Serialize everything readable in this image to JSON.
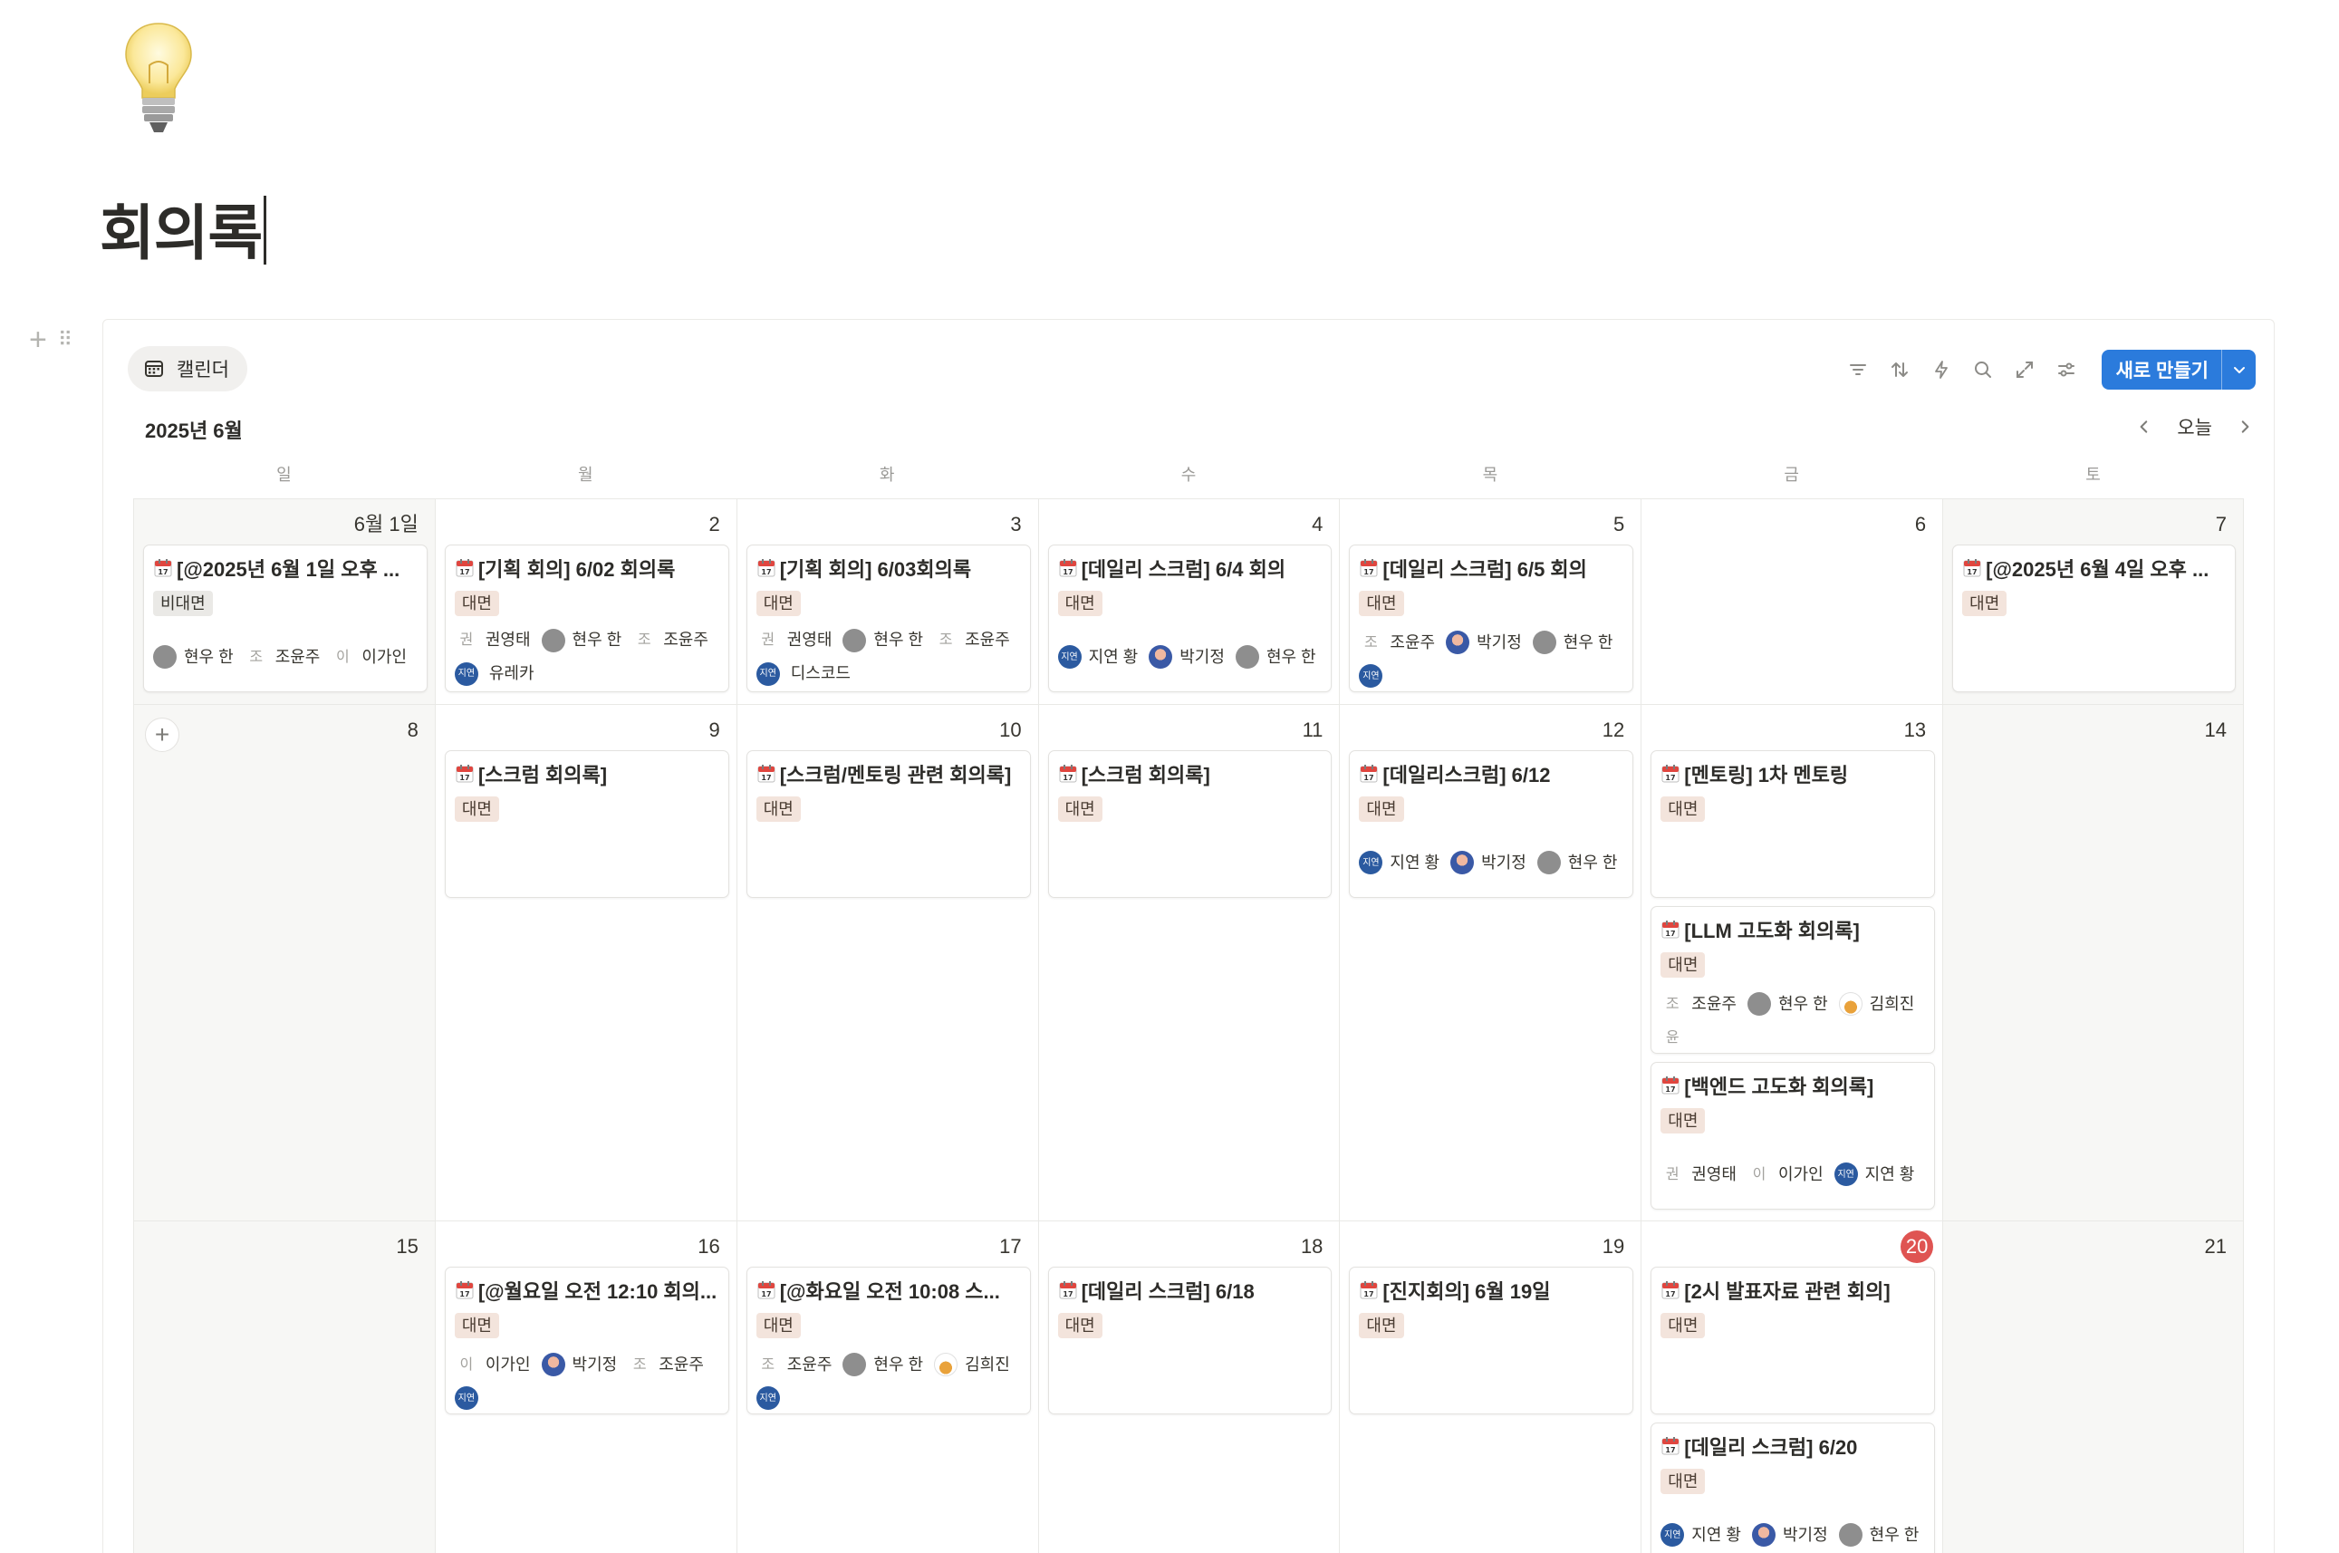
{
  "page": {
    "title": "회의록",
    "icon": "lightbulb-icon"
  },
  "view": {
    "tab_label": "캘린더",
    "month_label": "2025년 6월",
    "today_label": "오늘"
  },
  "toolbar": {
    "new_label": "새로 만들기",
    "accent": "#2b7bdc"
  },
  "weekdays": [
    "일",
    "월",
    "화",
    "수",
    "목",
    "금",
    "토"
  ],
  "tags": {
    "face": "대면",
    "nonface": "비대면"
  },
  "colors": {
    "tag_face_bg": "#f3e4dc",
    "tag_nonface_bg": "#eae9e6",
    "today": "#df5452"
  },
  "weeks": [
    {
      "days": [
        {
          "num": "6월 1일",
          "events": [
            {
              "title": "[@2025년 6월 1일 오후 ...",
              "tag": "비대면",
              "people": [
                {
                  "name": "현우 한",
                  "av": "gray"
                },
                {
                  "name": "조윤주",
                  "av": "조"
                },
                {
                  "name": "이가인",
                  "av": "이"
                }
              ]
            }
          ]
        },
        {
          "num": "2",
          "events": [
            {
              "title": "[기획 회의] 6/02 회의록",
              "tag": "대면",
              "people": [
                {
                  "name": "권영태",
                  "av": "권"
                },
                {
                  "name": "현우 한",
                  "av": "gray"
                },
                {
                  "name": "조윤주",
                  "av": "조"
                },
                {
                  "name": "",
                  "av": "blue"
                },
                {
                  "name": "유레카",
                  "av": ""
                }
              ]
            }
          ]
        },
        {
          "num": "3",
          "events": [
            {
              "title": "[기획 회의] 6/03회의록",
              "tag": "대면",
              "people": [
                {
                  "name": "권영태",
                  "av": "권"
                },
                {
                  "name": "현우 한",
                  "av": "gray"
                },
                {
                  "name": "조윤주",
                  "av": "조"
                },
                {
                  "name": "",
                  "av": "blue"
                },
                {
                  "name": "디스코드",
                  "av": ""
                }
              ]
            }
          ]
        },
        {
          "num": "4",
          "events": [
            {
              "title": "[데일리 스크럼] 6/4 회의",
              "tag": "대면",
              "people": [
                {
                  "name": "지연 황",
                  "av": "blue"
                },
                {
                  "name": "박기정",
                  "av": "photo"
                },
                {
                  "name": "현우 한",
                  "av": "gray"
                }
              ]
            }
          ]
        },
        {
          "num": "5",
          "events": [
            {
              "title": "[데일리 스크럼] 6/5 회의",
              "tag": "대면",
              "people": [
                {
                  "name": "조윤주",
                  "av": "조"
                },
                {
                  "name": "박기정",
                  "av": "photo"
                },
                {
                  "name": "현우 한",
                  "av": "gray"
                },
                {
                  "name": "",
                  "av": "blue"
                }
              ]
            }
          ]
        },
        {
          "num": "6",
          "events": []
        },
        {
          "num": "7",
          "events": [
            {
              "title": "[@2025년 6월 4일 오후 ...",
              "tag": "대면",
              "people": []
            }
          ]
        }
      ]
    },
    {
      "days": [
        {
          "num": "8",
          "events": []
        },
        {
          "num": "9",
          "events": [
            {
              "title": "[스크럼 회의록]",
              "tag": "대면",
              "people": []
            }
          ]
        },
        {
          "num": "10",
          "events": [
            {
              "title": "[스크럼/멘토링 관련 회의록]",
              "tag": "대면",
              "people": []
            }
          ]
        },
        {
          "num": "11",
          "events": [
            {
              "title": "[스크럼 회의록]",
              "tag": "대면",
              "people": []
            }
          ]
        },
        {
          "num": "12",
          "events": [
            {
              "title": "[데일리스크럼] 6/12",
              "tag": "대면",
              "people": [
                {
                  "name": "지연 황",
                  "av": "blue"
                },
                {
                  "name": "박기정",
                  "av": "photo"
                },
                {
                  "name": "현우 한",
                  "av": "gray"
                }
              ]
            }
          ]
        },
        {
          "num": "13",
          "events": [
            {
              "title": "[멘토링] 1차 멘토링",
              "tag": "대면",
              "people": []
            },
            {
              "title": "[LLM 고도화 회의록]",
              "tag": "대면",
              "people": [
                {
                  "name": "조윤주",
                  "av": "조"
                },
                {
                  "name": "현우 한",
                  "av": "gray"
                },
                {
                  "name": "김희진",
                  "av": "bowl"
                },
                {
                  "name": "",
                  "av": "윤"
                }
              ]
            },
            {
              "title": "[백엔드 고도화 회의록]",
              "tag": "대면",
              "people": [
                {
                  "name": "권영태",
                  "av": "권"
                },
                {
                  "name": "이가인",
                  "av": "이"
                },
                {
                  "name": "지연 황",
                  "av": "blue"
                }
              ]
            }
          ]
        },
        {
          "num": "14",
          "events": []
        }
      ]
    },
    {
      "days": [
        {
          "num": "15",
          "events": []
        },
        {
          "num": "16",
          "events": [
            {
              "title": "[@월요일 오전 12:10 회의...",
              "tag": "대면",
              "people": [
                {
                  "name": "이가인",
                  "av": "이"
                },
                {
                  "name": "박기정",
                  "av": "photo"
                },
                {
                  "name": "조윤주",
                  "av": "조"
                },
                {
                  "name": "",
                  "av": "blue"
                }
              ]
            }
          ]
        },
        {
          "num": "17",
          "events": [
            {
              "title": "[@화요일 오전 10:08 스...",
              "tag": "대면",
              "people": [
                {
                  "name": "조윤주",
                  "av": "조"
                },
                {
                  "name": "현우 한",
                  "av": "gray"
                },
                {
                  "name": "김희진",
                  "av": "bowl"
                },
                {
                  "name": "",
                  "av": "blue"
                }
              ]
            }
          ]
        },
        {
          "num": "18",
          "events": [
            {
              "title": "[데일리 스크럼] 6/18",
              "tag": "대면",
              "people": []
            }
          ]
        },
        {
          "num": "19",
          "events": [
            {
              "title": "[진지회의] 6월 19일",
              "tag": "대면",
              "people": []
            }
          ]
        },
        {
          "num": "20",
          "today": true,
          "events": [
            {
              "title": "[2시 발표자료 관련 회의]",
              "tag": "대면",
              "people": []
            },
            {
              "title": "[데일리 스크럼] 6/20",
              "tag": "대면",
              "people": [
                {
                  "name": "지연 황",
                  "av": "blue"
                },
                {
                  "name": "박기정",
                  "av": "photo"
                },
                {
                  "name": "현우 한",
                  "av": "gray"
                }
              ]
            }
          ]
        },
        {
          "num": "21",
          "events": []
        }
      ]
    }
  ]
}
